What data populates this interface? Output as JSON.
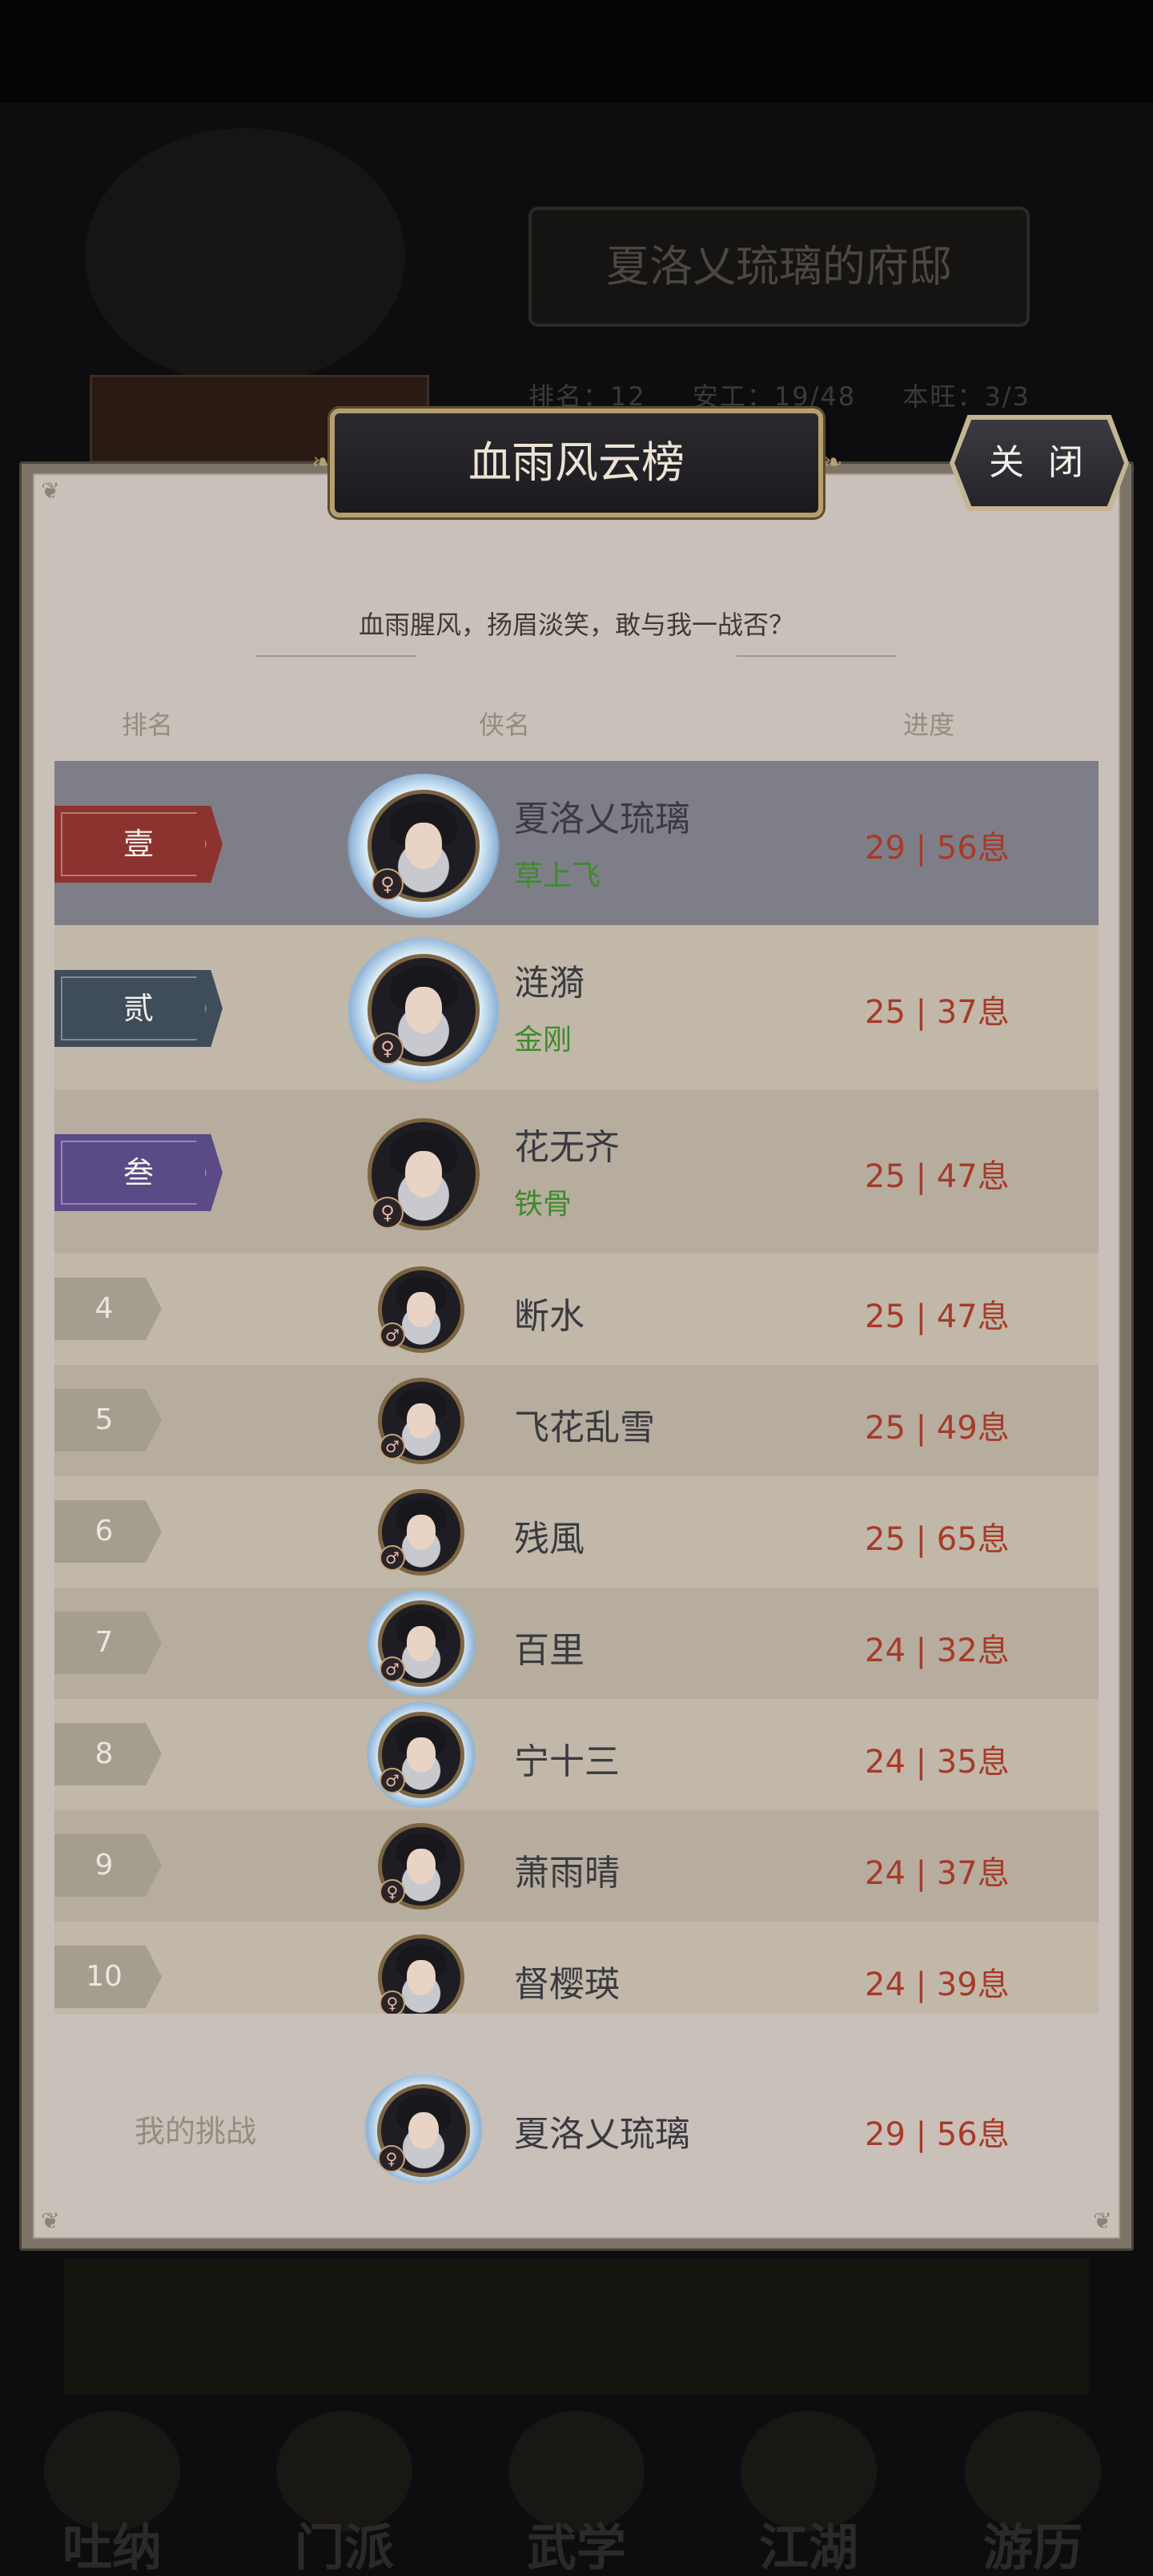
{
  "background": {
    "title": "夏洛乂琉璃的府邸",
    "stats": [
      "排名：12",
      "安工：19/48",
      "本旺：3/3"
    ],
    "nav": [
      "吐纳",
      "门派",
      "武学",
      "江湖",
      "游历"
    ]
  },
  "dialog": {
    "title": "血雨风云榜",
    "close_label": "关 闭",
    "slogan": "血雨腥风，扬眉淡笑，敢与我一战否？",
    "headers": {
      "rank": "排名",
      "hero": "侠名",
      "progress": "进度"
    }
  },
  "ranking": [
    {
      "rank": "壹",
      "name": "夏洛乂琉璃",
      "skill": "草上飞",
      "progress": "29 | 56息",
      "gender": "♀"
    },
    {
      "rank": "贰",
      "name": "涟漪",
      "skill": "金刚",
      "progress": "25 | 37息",
      "gender": "♀"
    },
    {
      "rank": "叁",
      "name": "花无齐",
      "skill": "铁骨",
      "progress": "25 | 47息",
      "gender": "♀"
    },
    {
      "rank": "4",
      "name": "断水",
      "skill": "",
      "progress": "25 | 47息",
      "gender": "♂"
    },
    {
      "rank": "5",
      "name": "飞花乱雪",
      "skill": "",
      "progress": "25 | 49息",
      "gender": "♂"
    },
    {
      "rank": "6",
      "name": "残風",
      "skill": "",
      "progress": "25 | 65息",
      "gender": "♂"
    },
    {
      "rank": "7",
      "name": "百里",
      "skill": "",
      "progress": "24 | 32息",
      "gender": "♂"
    },
    {
      "rank": "8",
      "name": "宁十三",
      "skill": "",
      "progress": "24 | 35息",
      "gender": "♂"
    },
    {
      "rank": "9",
      "name": "萧雨晴",
      "skill": "",
      "progress": "24 | 37息",
      "gender": "♀"
    },
    {
      "rank": "10",
      "name": "督樱瑛",
      "skill": "",
      "progress": "24 | 39息",
      "gender": "♀"
    }
  ],
  "my_challenge": {
    "label": "我的挑战",
    "name": "夏洛乂琉璃",
    "progress": "29 | 56息",
    "gender": "♀"
  },
  "colors": {
    "rank1": "#8c3330",
    "rank2": "#3f4c5a",
    "rank3": "#5a4a86",
    "progress": "#a83a28",
    "skill": "#3f8a2c"
  }
}
